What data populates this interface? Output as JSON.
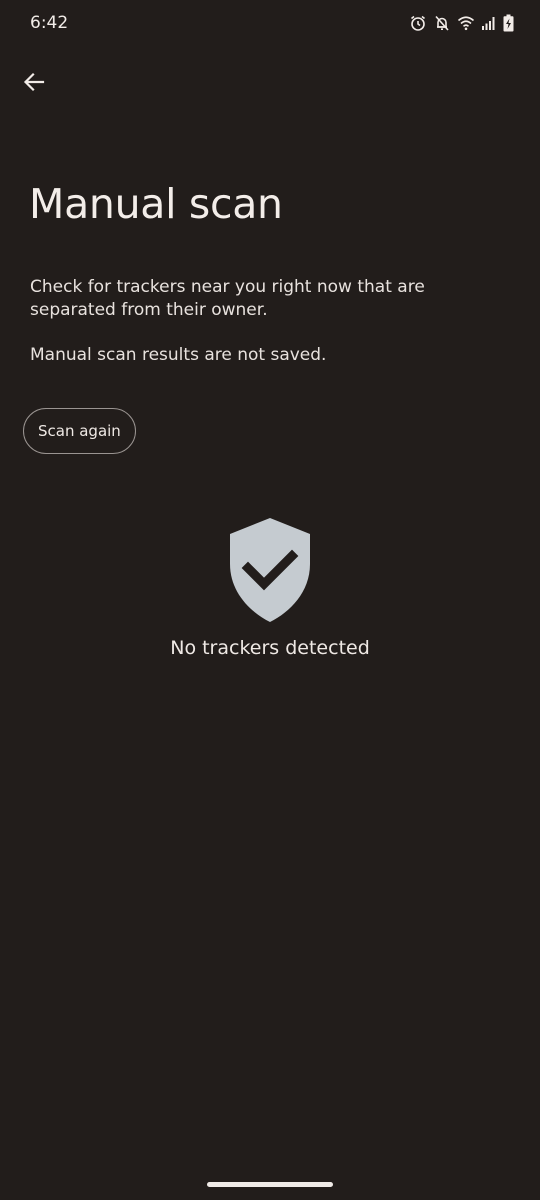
{
  "status_bar": {
    "time": "6:42",
    "icons": [
      "alarm-icon",
      "notifications-off-icon",
      "wifi-icon",
      "signal-icon",
      "battery-charging-icon"
    ]
  },
  "header": {
    "back_icon": "arrow-back-icon"
  },
  "main": {
    "title": "Manual scan",
    "description": "Check for trackers near you right now that are separated from their owner.",
    "note": "Manual scan results are not saved.",
    "scan_button_label": "Scan again",
    "result": {
      "icon": "shield-check-icon",
      "text": "No trackers detected"
    }
  },
  "colors": {
    "background": "#221d1b",
    "text": "#ece6e2",
    "shield": "#c5cbd0",
    "check": "#221d1b"
  }
}
